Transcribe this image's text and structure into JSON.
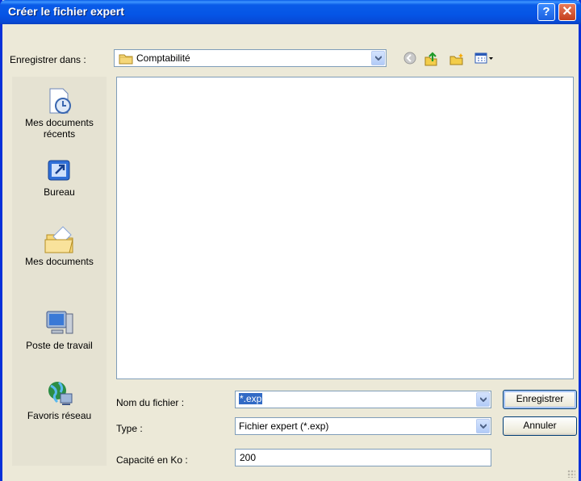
{
  "window": {
    "title": "Créer le fichier expert",
    "help": "?",
    "close": "✕"
  },
  "toolbar": {
    "save_in_label": "Enregistrer dans :",
    "location": "Comptabilité"
  },
  "places": [
    {
      "label": "Mes documents récents",
      "icon": "recent-documents-icon"
    },
    {
      "label": "Bureau",
      "icon": "desktop-icon"
    },
    {
      "label": "Mes documents",
      "icon": "my-documents-icon"
    },
    {
      "label": "Poste de travail",
      "icon": "my-computer-icon"
    },
    {
      "label": "Favoris réseau",
      "icon": "network-places-icon"
    }
  ],
  "form": {
    "filename_label": "Nom du fichier :",
    "filename_value": "*.exp",
    "type_label": "Type :",
    "type_value": "Fichier expert (*.exp)",
    "capacity_label": "Capacité en Ko :",
    "capacity_value": "200"
  },
  "buttons": {
    "save": "Enregistrer",
    "cancel": "Annuler"
  }
}
